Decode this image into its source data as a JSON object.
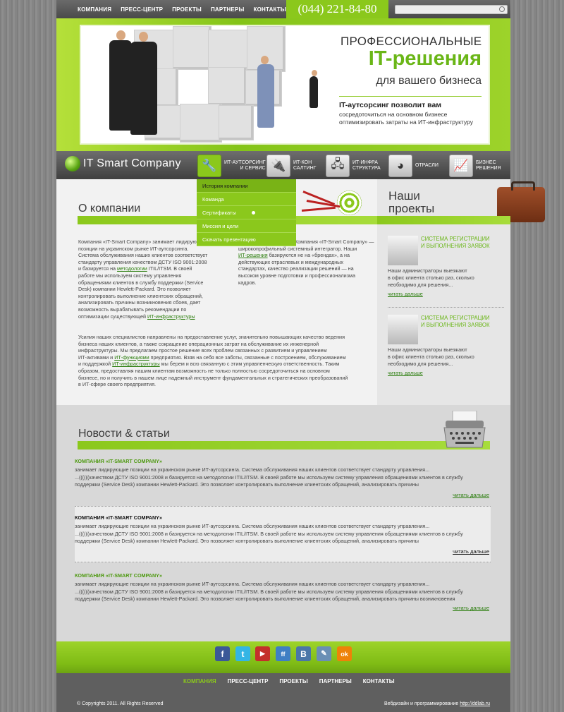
{
  "topnav": {
    "items": [
      "КОМПАНИЯ",
      "ПРЕСС-ЦЕНТР",
      "ПРОЕКТЫ",
      "ПАРТНЕРЫ",
      "КОНТАКТЫ"
    ],
    "phone": "(044) 221-84-80",
    "search_placeholder": ""
  },
  "hero": {
    "line1": "ПРОФЕССИОНАЛЬНЫЕ",
    "line2": "IT-решения",
    "line3": "для вашего бизнеса",
    "sub_title": "IT-аутсорсинг позволит вам",
    "sub_l1": "сосредоточиться на основном бизнесе",
    "sub_l2": "оптимизировать затраты на ИТ-инфраструктуру"
  },
  "logo": {
    "text": "IT Smart Company"
  },
  "mainmenu": [
    {
      "l1": "ИТ-аутсорсинг",
      "l2": "и сервис",
      "icon": "tools-icon"
    },
    {
      "l1": "ИТ-кон",
      "l2": "салтинг",
      "icon": "plug-icon"
    },
    {
      "l1": "ИТ-инфра",
      "l2": "структура",
      "icon": "network-icon"
    },
    {
      "l1": "Отрасли",
      "l2": "",
      "icon": "pie-chart-icon"
    },
    {
      "l1": "Бизнес",
      "l2": "решения",
      "icon": "presentation-icon"
    }
  ],
  "dropdown": [
    "История компании",
    "Команда",
    "Сертификаты",
    "Миссия и цели",
    "Скачать презентацию"
  ],
  "about": {
    "title": "О компании",
    "col1": [
      "Компания «IT-Smart Company» занимает лидирующие",
      "позиции на украинском рынке ИТ-аутсорсинга.",
      "Система обслуживания наших клиентов соответствует",
      "стандарту управления качеством ДСТУ ISO 9001:2008",
      "и базируется на "
    ],
    "col1_link1": "методологии",
    "col1_after1": " ITIL/ITSM. В своей",
    "col1b": [
      "работе мы используем систему управления",
      "обращениями клиентов в службу поддержки (Service",
      "Desk) компании Hewlett-Packard. Это позволяет",
      "контролировать выполнение клиентских обращений,",
      "анализировать причины возникновения сбоев, дает",
      "возможность вырабатывать рекомендации по",
      "оптимизации существующей "
    ],
    "col1_link2": "ИТ-инфраструктуры",
    "col2_l1": "Компания «IT-Smart Company» —",
    "col2_l2": "широкопрофильный системный интегратор. Наши",
    "col2_link": "ИТ-решения",
    "col2_after": " базируются не на «брендах», а на",
    "col2_rest": [
      "действующих отраслевых и международных",
      "стандартах, качество реализации решений — на",
      "высоком уровне подготовки и профессионализма",
      "кадров."
    ],
    "para_l1": "Усилия наших специалистов направлены на предоставление услуг, значительно повышающих качество ведения",
    "para_l2": "бизнеса наших клиентов, а также сокращение операционных затрат на обслуживание их инженерной",
    "para_l3": "инфраструктуры. Мы предлагаем простое решение всех проблем связанных с развитием и управлением",
    "para_l4a": "ИТ-активами и ",
    "para_link1": "ИТ-функциями",
    "para_l4b": " предприятия. Взяв на себя все заботы, связанные с построением, обслуживанием",
    "para_l5a": "и поддержкой ",
    "para_link2": "ИТ-инфраструктуры",
    "para_l5b": " мы берем и всю связанную с этим управленческую ответственность. Таким",
    "para_l6": "образом, предоставляя нашим клиентам возможность не только полностью сосредоточиться на основном",
    "para_l7": "бизнесе, но и получить в нашем лице надежный инструмент фундаментальных и стратегических преобразований",
    "para_l8": "в ИТ-сфере своего предприятия."
  },
  "projects": {
    "title_l1": "Наши",
    "title_l2": "проекты",
    "items": [
      {
        "title_l1": "СИСТЕМА РЕГИСТРАЦИИ",
        "title_l2": "И ВЫПОЛНЕНИЯ ЗАЯВОК",
        "d1": "Наши администраторы выезжают",
        "d2": "в офис клиента столько раз, сколько",
        "d3": "необходимо для решения...",
        "more": "читать дальше"
      },
      {
        "title_l1": "СИСТЕМА РЕГИСТРАЦИИ",
        "title_l2": "И ВЫПОЛНЕНИЯ ЗАЯВОК",
        "d1": "Наши администраторы выезжают",
        "d2": "в офис клиента столько раз, сколько",
        "d3": "необходимо для решения...",
        "more": "читать дальше"
      }
    ]
  },
  "news": {
    "title": "Новости & статьи",
    "items": [
      {
        "title": "КОМПАНИЯ «IT-SMART COMPANY»",
        "l1": "занимает лидирующие позиции на украинском рынке ИТ-аутсорсинга. Система обслуживания наших клиентов соответствует стандарту управления...",
        "l2": "...((((((качеством ДСТУ ISO 9001:2008 и базируется на методологии ITIL/ITSM. В своей работе мы используем систему управления обращениями клиентов в службу",
        "l3": "поддержки (Service Desk) компании Hewlett-Packard. Это позволяет контролировать выполнение клиентских обращений, анализировать причины",
        "more": "читать дальше"
      },
      {
        "title": "КОМПАНИЯ «IT-SMART COMPANY»",
        "l1": "занимает лидирующие позиции на украинском рынке ИТ-аутсорсинга. Система обслуживания наших клиентов соответствует стандарту управления...",
        "l2": "...((((((качеством ДСТУ ISO 9001:2008 и базируется на методологии ITIL/ITSM. В своей работе мы используем систему управления обращениями клиентов в службу",
        "l3": "поддержки (Service Desk) компании Hewlett-Packard. Это позволяет контролировать выполнение клиентских обращений, анализировать причины",
        "more": "читать дальше"
      },
      {
        "title": "КОМПАНИЯ «IT-SMART COMPANY»",
        "l1": "занимает лидирующие позиции на украинском рынке ИТ-аутсорсинга. Система обслуживания наших клиентов соответствует стандарту управления...",
        "l2": "...((((((качеством ДСТУ ISO 9001:2008 и базируется на методологии ITIL/ITSM. В своей работе мы используем систему управления обращениями клиентов в службу",
        "l3": "поддержки (Service Desk) компании Hewlett-Packard. Это позволяет контролировать выполнение клиентских обращений, анализировать причины возникновения",
        "more": "читать дальше"
      }
    ]
  },
  "social": [
    {
      "icon": "facebook-icon",
      "glyph": "f",
      "color": "#3b5998"
    },
    {
      "icon": "twitter-icon",
      "glyph": "t",
      "color": "#33b5e5"
    },
    {
      "icon": "youtube-icon",
      "glyph": "▶",
      "color": "#c4302b"
    },
    {
      "icon": "friendfeed-icon",
      "glyph": "ff",
      "color": "#3f7fc4"
    },
    {
      "icon": "vkontakte-icon",
      "glyph": "B",
      "color": "#4a76a8"
    },
    {
      "icon": "livejournal-icon",
      "glyph": "✎",
      "color": "#6a8fb5"
    },
    {
      "icon": "odnoklassniki-icon",
      "glyph": "ok",
      "color": "#ee8208"
    }
  ],
  "footer": {
    "nav": [
      "КОМПАНИЯ",
      "ПРЕСС-ЦЕНТР",
      "ПРОЕКТЫ",
      "ПАРТНЕРЫ",
      "КОНТАКТЫ"
    ],
    "copyright": "© Copyrights 2011. All Rights Reserved",
    "dev_text": "Вебдизайн и программирование ",
    "dev_link": "http://ddlab.ru"
  },
  "colors": {
    "accent": "#8bc81c",
    "accent_dark": "#6ab617",
    "topbar": "#555555"
  }
}
